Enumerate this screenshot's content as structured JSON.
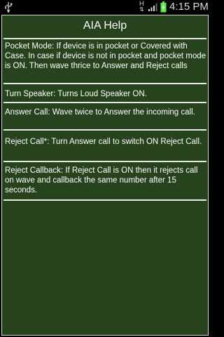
{
  "status_bar": {
    "network_type": "H",
    "time": "4:15 PM",
    "icons": [
      "usb-icon",
      "signal-icon",
      "battery-charging-icon"
    ]
  },
  "app": {
    "title": "AIA Help",
    "sections": [
      {
        "text": "Pocket Mode:  If device is in pocket or Covered with Case. In case if device is not in pocket and pocket mode is ON. Then wave thrice to Answer and Reject calls"
      },
      {
        "text": "Turn Speaker: Turns Loud Speaker ON."
      },
      {
        "text": "Answer Call:  Wave twice to Answer the incoming call."
      },
      {
        "text": "Reject Call*:  Turn Answer call to switch ON Reject Call."
      },
      {
        "text": "Reject Callback:  If Reject Call is ON then it rejects call on wave and callback the same number after 15 seconds."
      }
    ]
  },
  "colors": {
    "background": "#27431d",
    "text": "#ffffff",
    "divider": "#e9ece6",
    "battery": "#55ee44"
  }
}
